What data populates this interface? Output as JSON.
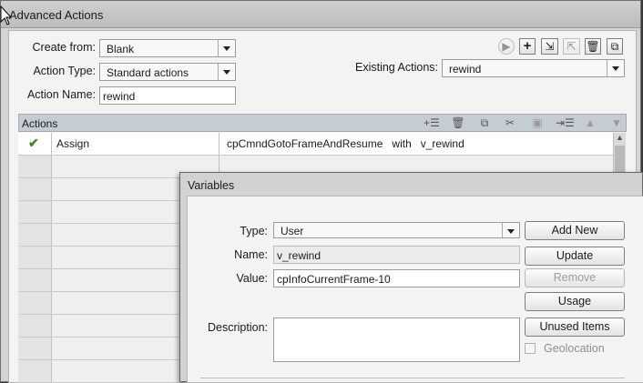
{
  "window": {
    "title": "Advanced Actions"
  },
  "form": {
    "create_from_label": "Create from:",
    "create_from_value": "Blank",
    "action_type_label": "Action Type:",
    "action_type_value": "Standard actions",
    "action_name_label": "Action Name:",
    "action_name_value": "rewind",
    "existing_label": "Existing Actions:",
    "existing_value": "rewind"
  },
  "toolbar_icons": [
    "preview-icon",
    "add-icon",
    "import-icon",
    "export-icon",
    "delete-icon",
    "duplicate-icon"
  ],
  "actions": {
    "header": "Actions",
    "icons": [
      "add-row-icon",
      "delete-row-icon",
      "copy-icon",
      "cut-icon",
      "paste-icon",
      "insert-icon",
      "move-up-icon",
      "move-down-icon"
    ],
    "rows": [
      {
        "status": "✔",
        "action": "Assign",
        "detail": "cpCmndGotoFrameAndResume   with   v_rewind"
      }
    ]
  },
  "variables": {
    "title": "Variables",
    "type_label": "Type:",
    "type_value": "User",
    "name_label": "Name:",
    "name_value": "v_rewind",
    "value_label": "Value:",
    "value_value": "cpInfoCurrentFrame-10",
    "description_label": "Description:",
    "description_value": "",
    "buttons": {
      "add_new": "Add New",
      "update": "Update",
      "remove": "Remove",
      "usage": "Usage",
      "unused_items": "Unused Items"
    },
    "geolocation_label": "Geolocation"
  }
}
